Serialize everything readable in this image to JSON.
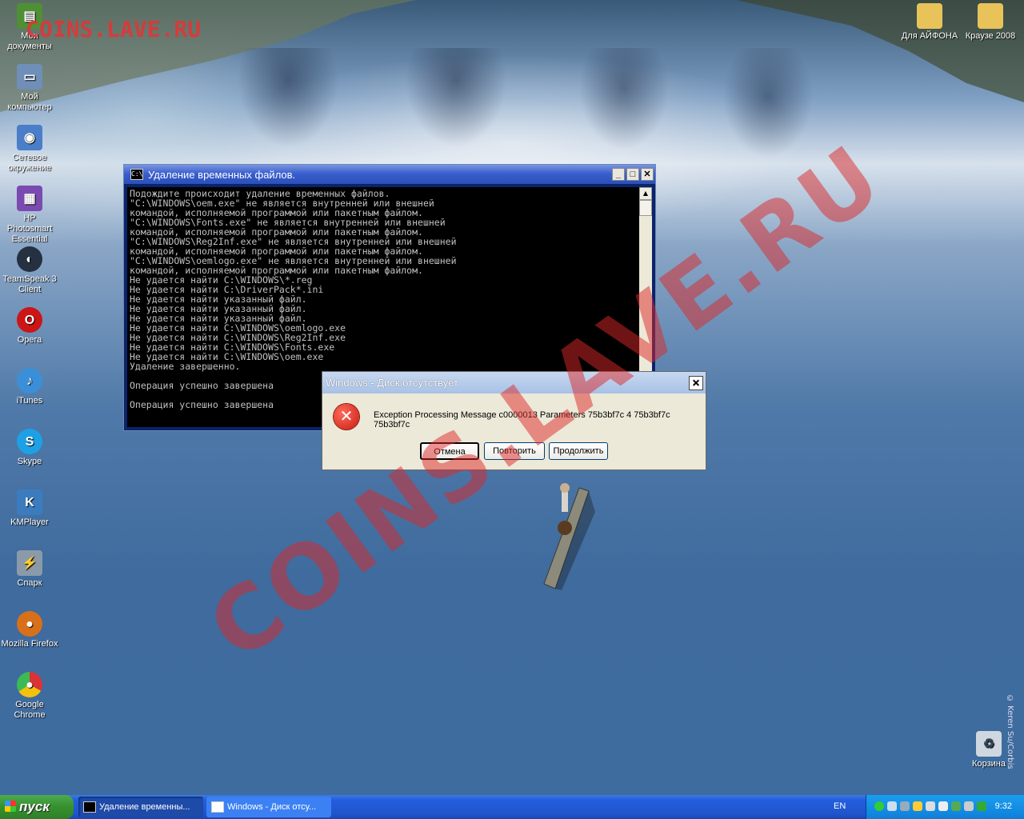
{
  "watermark": {
    "top": "COINS.LAVE.RU",
    "center": "COINS.LAVE.RU"
  },
  "wallpaper_credit": "© Keren Su/Corbis",
  "desktop_icons_left": [
    {
      "label": "Мои документы",
      "icon": "folder-docs-icon",
      "color": "#4f8f35"
    },
    {
      "label": "Мой компьютер",
      "icon": "computer-icon",
      "color": "#6f8fb8"
    },
    {
      "label": "Сетевое окружение",
      "icon": "network-icon",
      "color": "#4a7ec8"
    },
    {
      "label": "HP Photosmart Essential",
      "icon": "photo-icon",
      "color": "#7a4ab0"
    },
    {
      "label": "TeamSpeak 3 Client",
      "icon": "teamspeak-icon",
      "color": "#253040"
    },
    {
      "label": "Opera",
      "icon": "opera-icon",
      "color": "#cc1515"
    },
    {
      "label": "iTunes",
      "icon": "itunes-icon",
      "color": "#3a8fd8"
    },
    {
      "label": "Skype",
      "icon": "skype-icon",
      "color": "#1ea0e6"
    },
    {
      "label": "KMPlayer",
      "icon": "kmplayer-icon",
      "color": "#3b7cbf"
    },
    {
      "label": "Спарк",
      "icon": "spark-icon",
      "color": "#8a9aa8"
    },
    {
      "label": "Mozilla Firefox",
      "icon": "firefox-icon",
      "color": "#d8701a"
    },
    {
      "label": "Google Chrome",
      "icon": "chrome-icon",
      "color": "#3aa455"
    }
  ],
  "desktop_icons_right": [
    {
      "label": "Для АЙФОНА",
      "icon": "folder-icon",
      "color": "#e8c35a"
    },
    {
      "label": "Краузе 2008",
      "icon": "folder-icon",
      "color": "#e8c35a"
    }
  ],
  "recycle_bin": {
    "label": "Корзина",
    "icon": "recycle-bin-icon"
  },
  "cmd_window": {
    "title": "Удаление временных файлов.",
    "icon_text": "C:\\",
    "lines": [
      "Подождите происходит удаление временных файлов.",
      "\"C:\\WINDOWS\\oem.exe\" не является внутренней или внешней",
      "командой, исполняемой программой или пакетным файлом.",
      "\"C:\\WINDOWS\\Fonts.exe\" не является внутренней или внешней",
      "командой, исполняемой программой или пакетным файлом.",
      "\"C:\\WINDOWS\\Reg2Inf.exe\" не является внутренней или внешней",
      "командой, исполняемой программой или пакетным файлом.",
      "\"C:\\WINDOWS\\oemlogo.exe\" не является внутренней или внешней",
      "командой, исполняемой программой или пакетным файлом.",
      "Не удается найти C:\\WINDOWS\\*.reg",
      "Не удается найти C:\\DriverPack*.ini",
      "Не удается найти указанный файл.",
      "Не удается найти указанный файл.",
      "Не удается найти указанный файл.",
      "Не удается найти C:\\WINDOWS\\oemlogo.exe",
      "Не удается найти C:\\WINDOWS\\Reg2Inf.exe",
      "Не удается найти C:\\WINDOWS\\Fonts.exe",
      "Не удается найти C:\\WINDOWS\\oem.exe",
      "Удаление завершенно.",
      "",
      "Операция успешно завершена",
      "",
      "Операция успешно завершена"
    ]
  },
  "dialog": {
    "title": "Windows - Диск отсутствует",
    "message": "Exception Processing Message c0000013 Parameters 75b3bf7c 4 75b3bf7c 75b3bf7c",
    "buttons": {
      "cancel": "Отмена",
      "retry": "Повторить",
      "continue": "Продолжить"
    }
  },
  "taskbar": {
    "start_label": "пуск",
    "items": [
      {
        "label": "Удаление временны..."
      },
      {
        "label": "Windows - Диск отсу..."
      }
    ],
    "language": "EN",
    "clock": "9:32"
  }
}
